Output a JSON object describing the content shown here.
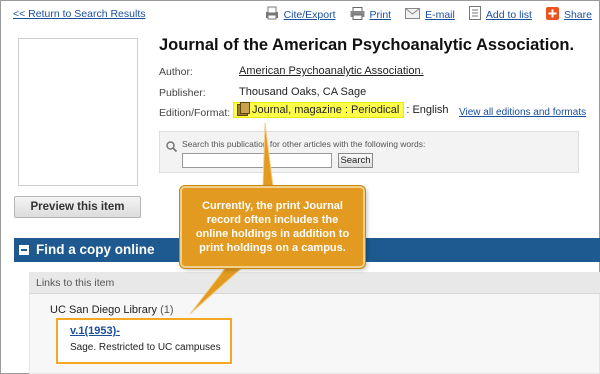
{
  "nav": {
    "return_label": "<< Return to Search Results"
  },
  "toolbar": {
    "cite": "Cite/Export",
    "print": "Print",
    "email": "E-mail",
    "add_to_list": "Add to list",
    "share": "Share"
  },
  "preview": {
    "button_label": "Preview this item"
  },
  "record": {
    "title": "Journal of the American Psychoanalytic Association.",
    "fields": {
      "author_label": "Author:",
      "author_value": "American Psychoanalytic Association.",
      "publisher_label": "Publisher:",
      "publisher_value": "Thousand Oaks, CA Sage",
      "edition_label": "Edition/Format:",
      "format_value": "Journal, magazine : Periodical",
      "language_value": ": English",
      "view_all": "View all editions and formats"
    }
  },
  "search_inside": {
    "hint": "Search this publication for other articles with the following words:",
    "input_value": "",
    "button_label": "Search"
  },
  "find_copy": {
    "section_title": "Find a copy online",
    "links_header": "Links to this item",
    "library_name": "UC San Diego Library",
    "library_count": "(1)",
    "holding_link": "v.1(1953)-",
    "holding_note": "Sage. Restricted to UC campuses"
  },
  "callout": {
    "text": "Currently, the print Journal record often includes the online holdings in addition to print holdings on a campus."
  },
  "colors": {
    "link": "#1a4f9c",
    "section_bar": "#1e5a8f",
    "callout_fill": "#e39a20",
    "highlight": "#ffff4a",
    "share_icon": "#e8531f"
  }
}
